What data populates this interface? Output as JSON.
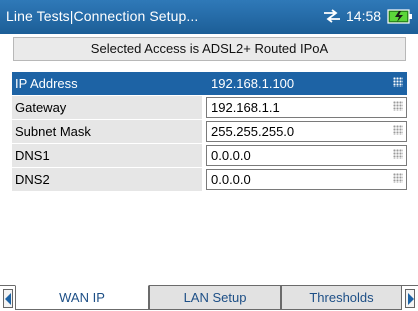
{
  "titlebar": {
    "title": "Line Tests|Connection Setup...",
    "clock": "14:58",
    "network_icon": "network-arrows-icon",
    "battery_icon": "battery-charging-icon"
  },
  "banner": {
    "text": "Selected Access  is ADSL2+ Routed IPoA"
  },
  "fields": [
    {
      "label": "IP Address",
      "value": "192.168.1.100",
      "selected": true
    },
    {
      "label": "Gateway",
      "value": "192.168.1.1",
      "selected": false
    },
    {
      "label": "Subnet Mask",
      "value": "255.255.255.0",
      "selected": false
    },
    {
      "label": "DNS1",
      "value": "0.0.0.0",
      "selected": false
    },
    {
      "label": "DNS2",
      "value": "0.0.0.0",
      "selected": false
    }
  ],
  "tabs": [
    {
      "label": "WAN IP",
      "active": true
    },
    {
      "label": "LAN Setup",
      "active": false
    },
    {
      "label": "Thresholds",
      "active": false
    }
  ],
  "colors": {
    "titlebar": "#1d63a5",
    "selection": "#1d63a5",
    "tab_text": "#1d4f86"
  }
}
